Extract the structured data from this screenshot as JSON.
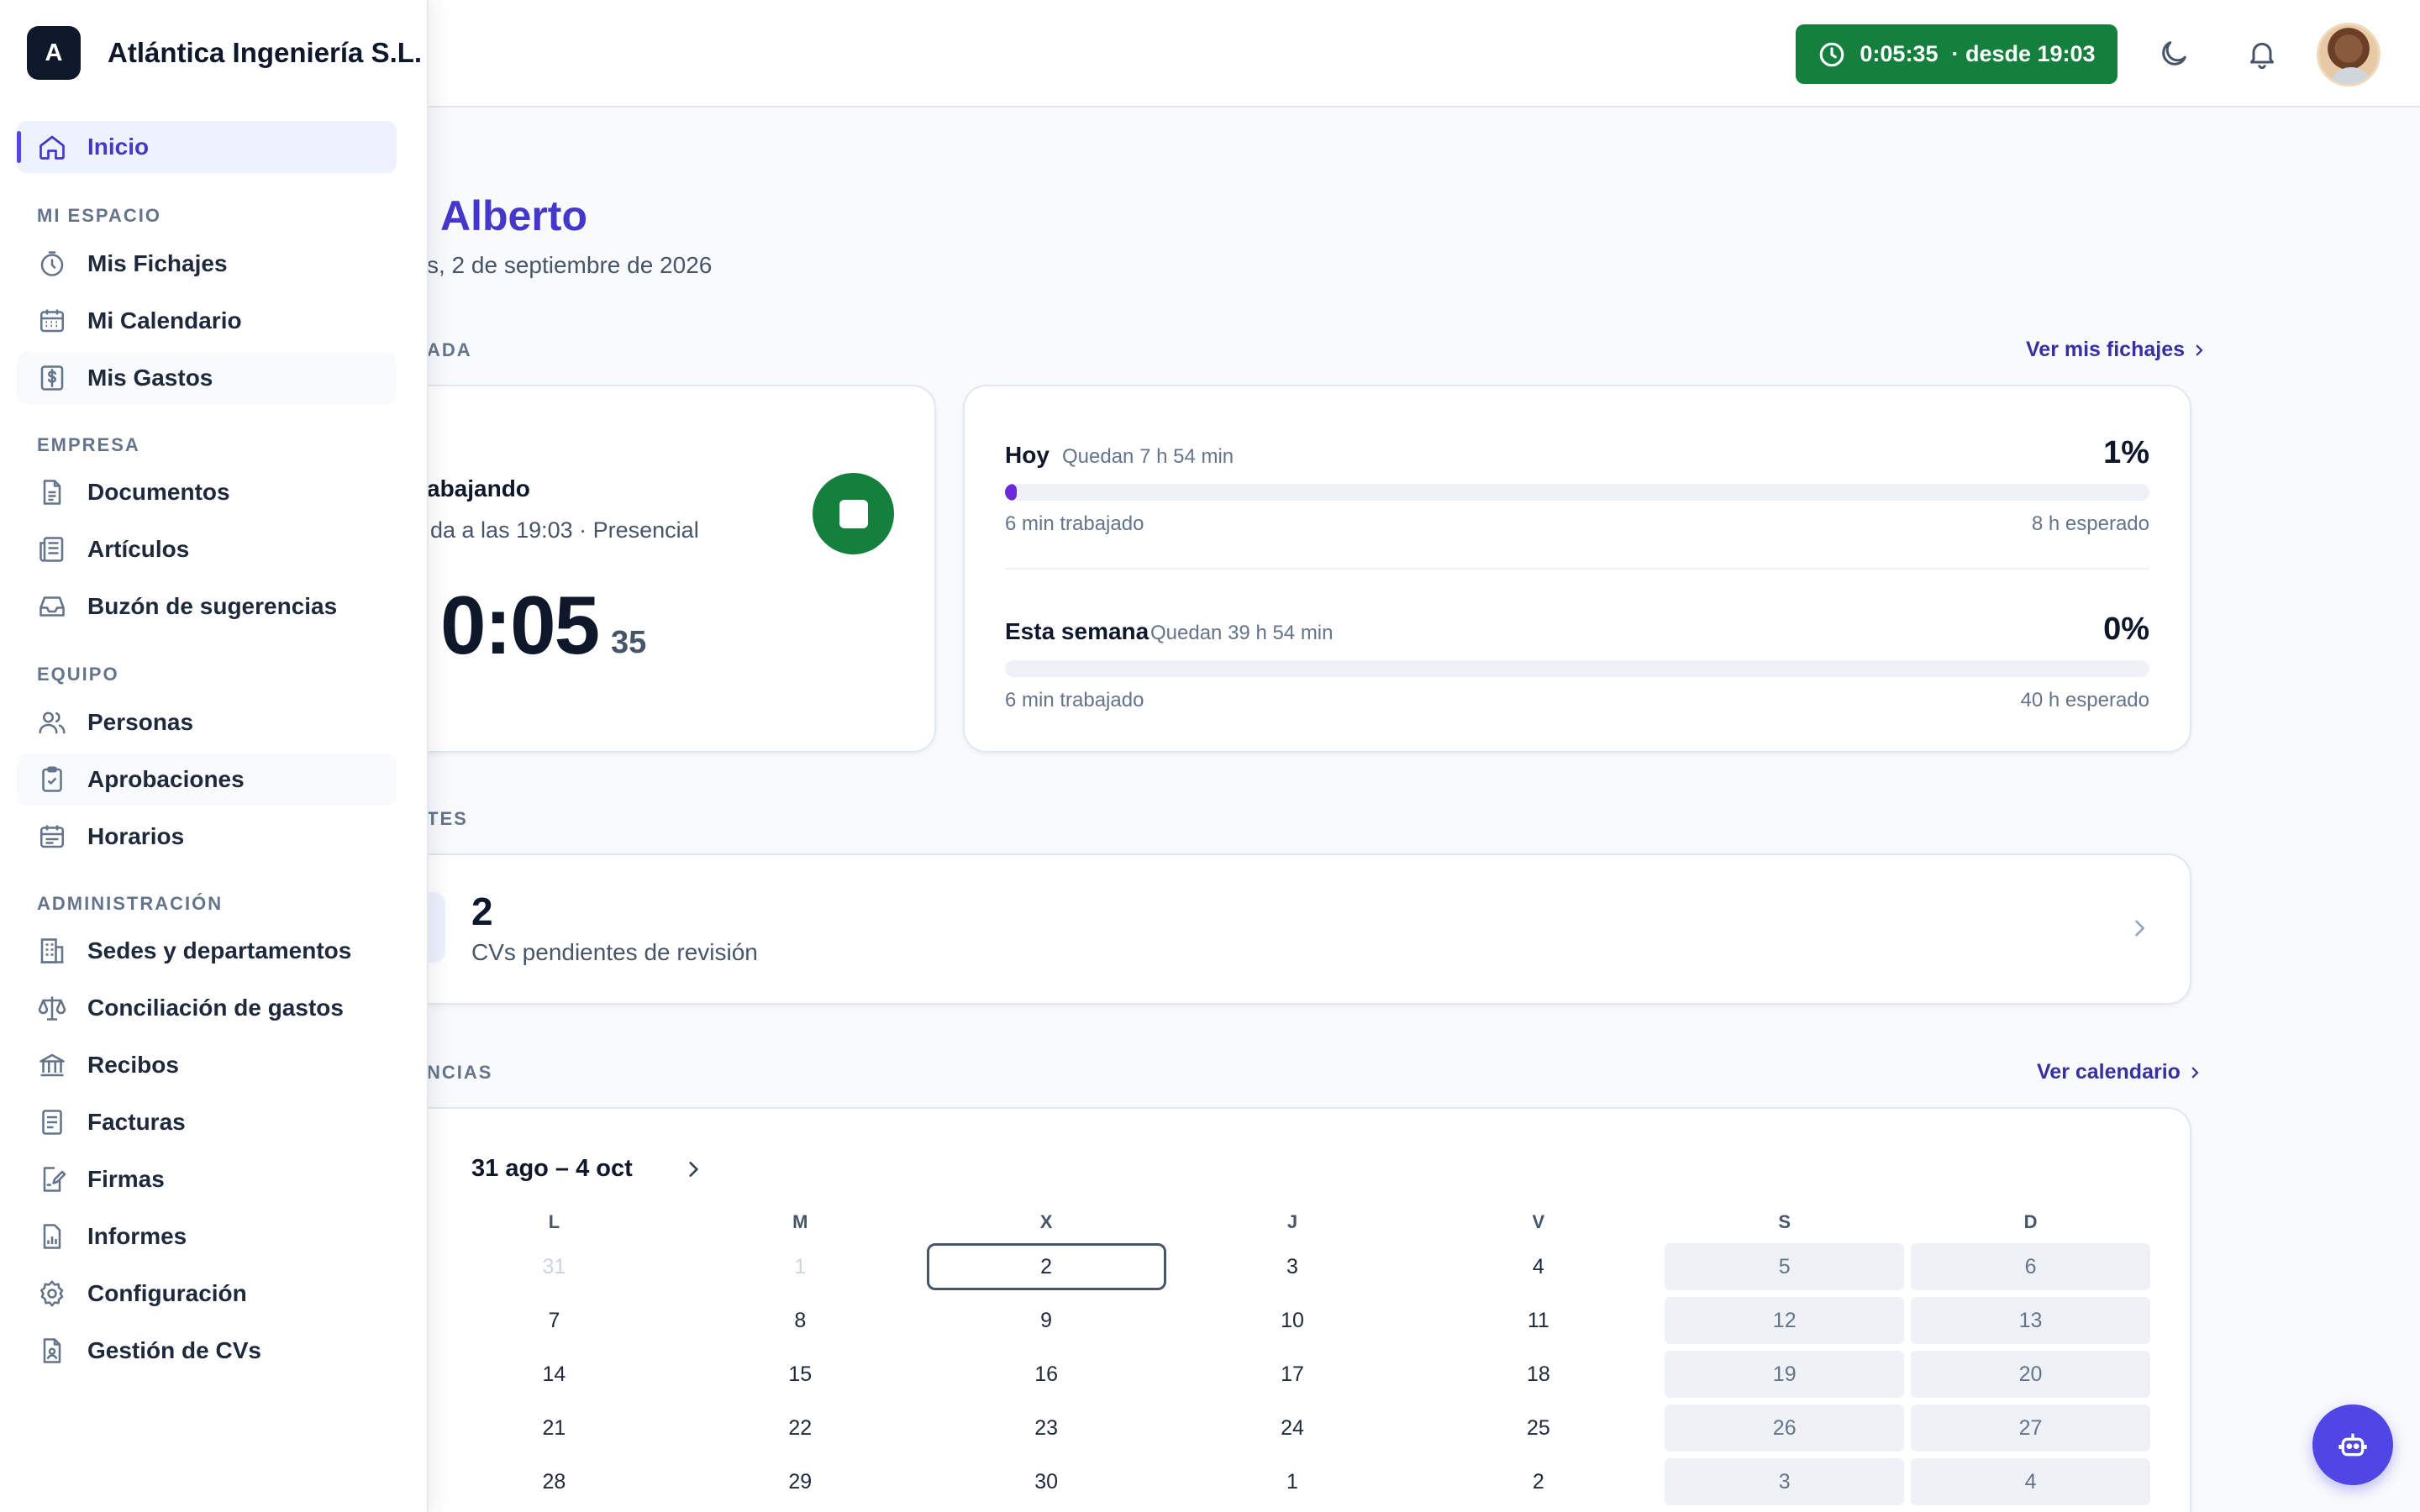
{
  "app": {
    "company": "Atlántica Ingeniería S.L.",
    "logo_letter": "A"
  },
  "topbar": {
    "timer_elapsed": "0:05:35",
    "timer_since": "· desde 19:03"
  },
  "greeting": {
    "name": "Alberto",
    "date": "s, 2 de septiembre de 2026"
  },
  "jornada": {
    "section_label": "ADA",
    "link": "Ver mis fichajes",
    "status": "abajando",
    "detail": "da a las 19:03 · Presencial",
    "elapsed_main": "0:05",
    "elapsed_seconds": "35"
  },
  "progress": {
    "today": {
      "title": "Hoy",
      "remaining": "Quedan 7 h 54 min",
      "percent_label": "1%",
      "fraction": 0.01,
      "worked": "6 min trabajado",
      "expected": "8 h esperado"
    },
    "week": {
      "title": "Esta semana",
      "remaining": "Quedan 39 h 54 min",
      "percent_label": "0%",
      "fraction": 0.0,
      "worked": "6 min trabajado",
      "expected": "40 h esperado"
    }
  },
  "pendientes": {
    "section_label": "TES",
    "count": "2",
    "text": "CVs pendientes de revisión"
  },
  "calendar": {
    "section_label": "NCIAS",
    "link": "Ver calendario",
    "range": "31 ago – 4 oct",
    "weekdays": [
      "L",
      "M",
      "X",
      "J",
      "V",
      "S",
      "D"
    ],
    "weeks": [
      [
        "31",
        "1",
        "2",
        "3",
        "4",
        "5",
        "6"
      ],
      [
        "7",
        "8",
        "9",
        "10",
        "11",
        "12",
        "13"
      ],
      [
        "14",
        "15",
        "16",
        "17",
        "18",
        "19",
        "20"
      ],
      [
        "21",
        "22",
        "23",
        "24",
        "25",
        "26",
        "27"
      ],
      [
        "28",
        "29",
        "30",
        "1",
        "2",
        "3",
        "4"
      ]
    ],
    "muted_cells": [
      "0-0",
      "0-1"
    ],
    "today_cell": "0-2"
  },
  "sidebar": {
    "home": {
      "label": "Inicio",
      "icon": "home-icon"
    },
    "groups": [
      {
        "title": "MI ESPACIO",
        "items": [
          {
            "label": "Mis Fichajes",
            "icon": "stopwatch-icon"
          },
          {
            "label": "Mi Calendario",
            "icon": "calendar-icon"
          },
          {
            "label": "Mis Gastos",
            "icon": "dollar-receipt-icon"
          }
        ]
      },
      {
        "title": "EMPRESA",
        "items": [
          {
            "label": "Documentos",
            "icon": "document-icon"
          },
          {
            "label": "Artículos",
            "icon": "newspaper-icon"
          },
          {
            "label": "Buzón de sugerencias",
            "icon": "inbox-icon"
          }
        ]
      },
      {
        "title": "EQUIPO",
        "items": [
          {
            "label": "Personas",
            "icon": "users-icon"
          },
          {
            "label": "Aprobaciones",
            "icon": "clipboard-check-icon"
          },
          {
            "label": "Horarios",
            "icon": "calendar-schedule-icon"
          }
        ]
      },
      {
        "title": "ADMINISTRACIÓN",
        "items": [
          {
            "label": "Sedes y departamentos",
            "icon": "building-icon"
          },
          {
            "label": "Conciliación de gastos",
            "icon": "scale-icon"
          },
          {
            "label": "Recibos",
            "icon": "bank-icon"
          },
          {
            "label": "Facturas",
            "icon": "invoice-icon"
          },
          {
            "label": "Firmas",
            "icon": "signature-icon"
          },
          {
            "label": "Informes",
            "icon": "report-icon"
          },
          {
            "label": "Configuración",
            "icon": "gear-icon"
          },
          {
            "label": "Gestión de CVs",
            "icon": "cv-icon"
          }
        ]
      }
    ]
  },
  "colors": {
    "accent": "#4f46e5",
    "success": "#15803d",
    "progress": "#6d28d9"
  }
}
